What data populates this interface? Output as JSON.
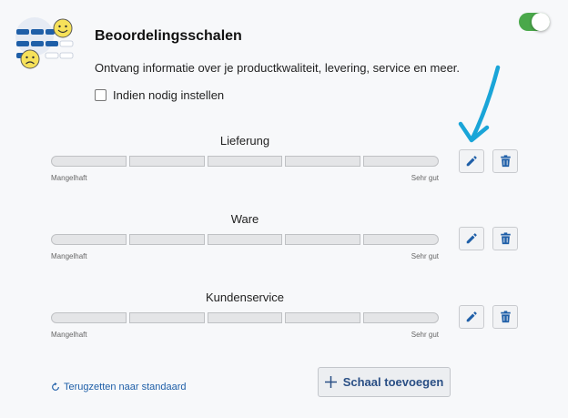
{
  "header": {
    "title": "Beoordelingsschalen",
    "description": "Ontvang informatie over je productkwaliteit, levering, service en meer.",
    "checkbox_label": "Indien nodig instellen",
    "toggle_on": true
  },
  "scales": [
    {
      "name": "Lieferung",
      "low_label": "Mangelhaft",
      "high_label": "Sehr gut",
      "segments": 5
    },
    {
      "name": "Ware",
      "low_label": "Mangelhaft",
      "high_label": "Sehr gut",
      "segments": 5
    },
    {
      "name": "Kundenservice",
      "low_label": "Mangelhaft",
      "high_label": "Sehr gut",
      "segments": 5
    }
  ],
  "footer": {
    "reset_label": "Terugzetten naar standaard",
    "add_label": "Schaal toevoegen"
  },
  "colors": {
    "toggle": "#4aa84a",
    "accent_blue": "#1f5fa8",
    "annotation_arrow": "#1aa5d8"
  },
  "icons": {
    "edit": "pencil-icon",
    "delete": "trash-icon",
    "reset": "refresh-icon",
    "add": "plus-icon"
  }
}
